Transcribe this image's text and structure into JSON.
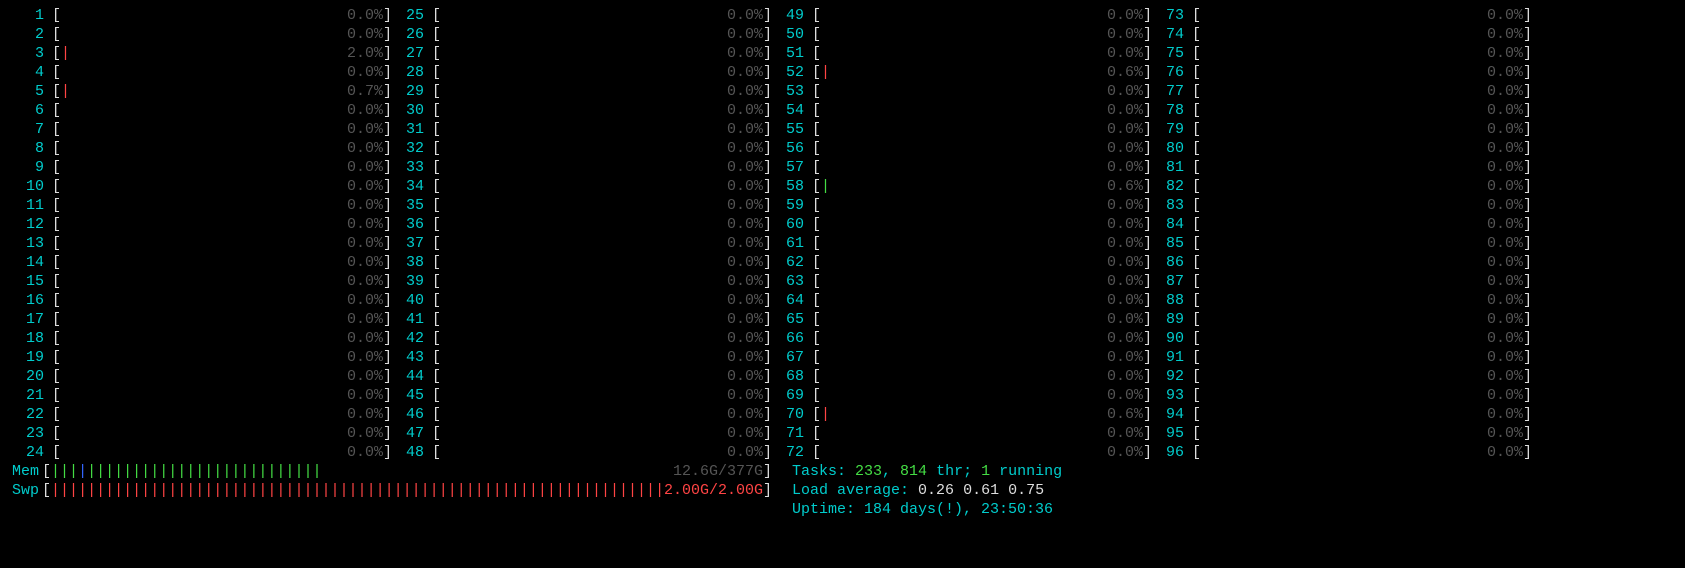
{
  "cpu_columns": [
    [
      {
        "n": 1,
        "pct": "0.0%",
        "bar": ""
      },
      {
        "n": 2,
        "pct": "0.0%",
        "bar": ""
      },
      {
        "n": 3,
        "pct": "2.0%",
        "bar": "|",
        "bar_color": "red"
      },
      {
        "n": 4,
        "pct": "0.0%",
        "bar": ""
      },
      {
        "n": 5,
        "pct": "0.7%",
        "bar": "|",
        "bar_color": "red"
      },
      {
        "n": 6,
        "pct": "0.0%",
        "bar": ""
      },
      {
        "n": 7,
        "pct": "0.0%",
        "bar": ""
      },
      {
        "n": 8,
        "pct": "0.0%",
        "bar": ""
      },
      {
        "n": 9,
        "pct": "0.0%",
        "bar": ""
      },
      {
        "n": 10,
        "pct": "0.0%",
        "bar": ""
      },
      {
        "n": 11,
        "pct": "0.0%",
        "bar": ""
      },
      {
        "n": 12,
        "pct": "0.0%",
        "bar": ""
      },
      {
        "n": 13,
        "pct": "0.0%",
        "bar": ""
      },
      {
        "n": 14,
        "pct": "0.0%",
        "bar": ""
      },
      {
        "n": 15,
        "pct": "0.0%",
        "bar": ""
      },
      {
        "n": 16,
        "pct": "0.0%",
        "bar": ""
      },
      {
        "n": 17,
        "pct": "0.0%",
        "bar": ""
      },
      {
        "n": 18,
        "pct": "0.0%",
        "bar": ""
      },
      {
        "n": 19,
        "pct": "0.0%",
        "bar": ""
      },
      {
        "n": 20,
        "pct": "0.0%",
        "bar": ""
      },
      {
        "n": 21,
        "pct": "0.0%",
        "bar": ""
      },
      {
        "n": 22,
        "pct": "0.0%",
        "bar": ""
      },
      {
        "n": 23,
        "pct": "0.0%",
        "bar": ""
      },
      {
        "n": 24,
        "pct": "0.0%",
        "bar": ""
      }
    ],
    [
      {
        "n": 25,
        "pct": "0.0%",
        "bar": ""
      },
      {
        "n": 26,
        "pct": "0.0%",
        "bar": ""
      },
      {
        "n": 27,
        "pct": "0.0%",
        "bar": ""
      },
      {
        "n": 28,
        "pct": "0.0%",
        "bar": ""
      },
      {
        "n": 29,
        "pct": "0.0%",
        "bar": ""
      },
      {
        "n": 30,
        "pct": "0.0%",
        "bar": ""
      },
      {
        "n": 31,
        "pct": "0.0%",
        "bar": ""
      },
      {
        "n": 32,
        "pct": "0.0%",
        "bar": ""
      },
      {
        "n": 33,
        "pct": "0.0%",
        "bar": ""
      },
      {
        "n": 34,
        "pct": "0.0%",
        "bar": ""
      },
      {
        "n": 35,
        "pct": "0.0%",
        "bar": ""
      },
      {
        "n": 36,
        "pct": "0.0%",
        "bar": ""
      },
      {
        "n": 37,
        "pct": "0.0%",
        "bar": ""
      },
      {
        "n": 38,
        "pct": "0.0%",
        "bar": ""
      },
      {
        "n": 39,
        "pct": "0.0%",
        "bar": ""
      },
      {
        "n": 40,
        "pct": "0.0%",
        "bar": ""
      },
      {
        "n": 41,
        "pct": "0.0%",
        "bar": ""
      },
      {
        "n": 42,
        "pct": "0.0%",
        "bar": ""
      },
      {
        "n": 43,
        "pct": "0.0%",
        "bar": ""
      },
      {
        "n": 44,
        "pct": "0.0%",
        "bar": ""
      },
      {
        "n": 45,
        "pct": "0.0%",
        "bar": ""
      },
      {
        "n": 46,
        "pct": "0.0%",
        "bar": ""
      },
      {
        "n": 47,
        "pct": "0.0%",
        "bar": ""
      },
      {
        "n": 48,
        "pct": "0.0%",
        "bar": ""
      }
    ],
    [
      {
        "n": 49,
        "pct": "0.0%",
        "bar": ""
      },
      {
        "n": 50,
        "pct": "0.0%",
        "bar": ""
      },
      {
        "n": 51,
        "pct": "0.0%",
        "bar": ""
      },
      {
        "n": 52,
        "pct": "0.6%",
        "bar": "|",
        "bar_color": "red"
      },
      {
        "n": 53,
        "pct": "0.0%",
        "bar": ""
      },
      {
        "n": 54,
        "pct": "0.0%",
        "bar": ""
      },
      {
        "n": 55,
        "pct": "0.0%",
        "bar": ""
      },
      {
        "n": 56,
        "pct": "0.0%",
        "bar": ""
      },
      {
        "n": 57,
        "pct": "0.0%",
        "bar": ""
      },
      {
        "n": 58,
        "pct": "0.6%",
        "bar": "|",
        "bar_color": "grn"
      },
      {
        "n": 59,
        "pct": "0.0%",
        "bar": ""
      },
      {
        "n": 60,
        "pct": "0.0%",
        "bar": ""
      },
      {
        "n": 61,
        "pct": "0.0%",
        "bar": ""
      },
      {
        "n": 62,
        "pct": "0.0%",
        "bar": ""
      },
      {
        "n": 63,
        "pct": "0.0%",
        "bar": ""
      },
      {
        "n": 64,
        "pct": "0.0%",
        "bar": ""
      },
      {
        "n": 65,
        "pct": "0.0%",
        "bar": ""
      },
      {
        "n": 66,
        "pct": "0.0%",
        "bar": ""
      },
      {
        "n": 67,
        "pct": "0.0%",
        "bar": ""
      },
      {
        "n": 68,
        "pct": "0.0%",
        "bar": ""
      },
      {
        "n": 69,
        "pct": "0.0%",
        "bar": ""
      },
      {
        "n": 70,
        "pct": "0.6%",
        "bar": "|",
        "bar_color": "red"
      },
      {
        "n": 71,
        "pct": "0.0%",
        "bar": ""
      },
      {
        "n": 72,
        "pct": "0.0%",
        "bar": ""
      }
    ],
    [
      {
        "n": 73,
        "pct": "0.0%",
        "bar": ""
      },
      {
        "n": 74,
        "pct": "0.0%",
        "bar": ""
      },
      {
        "n": 75,
        "pct": "0.0%",
        "bar": ""
      },
      {
        "n": 76,
        "pct": "0.0%",
        "bar": ""
      },
      {
        "n": 77,
        "pct": "0.0%",
        "bar": ""
      },
      {
        "n": 78,
        "pct": "0.0%",
        "bar": ""
      },
      {
        "n": 79,
        "pct": "0.0%",
        "bar": ""
      },
      {
        "n": 80,
        "pct": "0.0%",
        "bar": ""
      },
      {
        "n": 81,
        "pct": "0.0%",
        "bar": ""
      },
      {
        "n": 82,
        "pct": "0.0%",
        "bar": ""
      },
      {
        "n": 83,
        "pct": "0.0%",
        "bar": ""
      },
      {
        "n": 84,
        "pct": "0.0%",
        "bar": ""
      },
      {
        "n": 85,
        "pct": "0.0%",
        "bar": ""
      },
      {
        "n": 86,
        "pct": "0.0%",
        "bar": ""
      },
      {
        "n": 87,
        "pct": "0.0%",
        "bar": ""
      },
      {
        "n": 88,
        "pct": "0.0%",
        "bar": ""
      },
      {
        "n": 89,
        "pct": "0.0%",
        "bar": ""
      },
      {
        "n": 90,
        "pct": "0.0%",
        "bar": ""
      },
      {
        "n": 91,
        "pct": "0.0%",
        "bar": ""
      },
      {
        "n": 92,
        "pct": "0.0%",
        "bar": ""
      },
      {
        "n": 93,
        "pct": "0.0%",
        "bar": ""
      },
      {
        "n": 94,
        "pct": "0.0%",
        "bar": ""
      },
      {
        "n": 95,
        "pct": "0.0%",
        "bar": ""
      },
      {
        "n": 96,
        "pct": "0.0%",
        "bar": ""
      }
    ]
  ],
  "mem": {
    "label": "Mem",
    "bar_segments": [
      {
        "color": "grn",
        "count": 3
      },
      {
        "color": "blu",
        "count": 1
      },
      {
        "color": "grn",
        "count": 26
      }
    ],
    "text": "12.6G/377G"
  },
  "swp": {
    "label": "Swp",
    "bar_segments": [
      {
        "color": "red",
        "count": 69
      }
    ],
    "text": "2.00G/2.00G"
  },
  "tasks": {
    "label": "Tasks: ",
    "procs": "233",
    "comma1": ", ",
    "thr": "814",
    "thr_label": " thr",
    "sep": "; ",
    "running": "1",
    "running_label": " running"
  },
  "load": {
    "label": "Load average: ",
    "v1": "0.26",
    "v2": "0.61",
    "v3": "0.75"
  },
  "uptime": {
    "label": "Uptime: ",
    "value": "184 days(!), 23:50:36"
  }
}
